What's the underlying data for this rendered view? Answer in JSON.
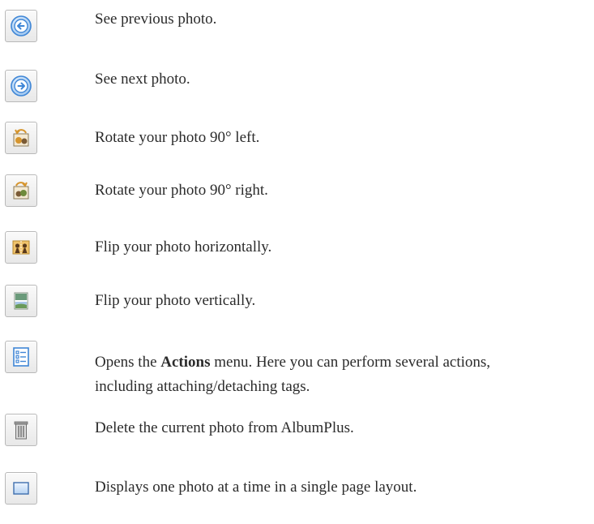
{
  "items": [
    {
      "icon": "previous-arrow-icon",
      "text": "See previous photo."
    },
    {
      "icon": "next-arrow-icon",
      "text": "See next photo."
    },
    {
      "icon": "rotate-left-icon",
      "text": "Rotate your photo 90° left."
    },
    {
      "icon": "rotate-right-icon",
      "text": "Rotate your photo 90° right."
    },
    {
      "icon": "flip-horizontal-icon",
      "text": "Flip your photo horizontally."
    },
    {
      "icon": "flip-vertical-icon",
      "text": "Flip your photo vertically."
    },
    {
      "icon": "actions-menu-icon",
      "text_before": "Opens the ",
      "bold": "Actions",
      "text_after": " menu. Here you can perform several actions,",
      "line2": "including attaching/detaching tags."
    },
    {
      "icon": "trash-icon",
      "text": "Delete the current photo from AlbumPlus."
    },
    {
      "icon": "single-page-layout-icon",
      "text": "Displays one photo at a time in a single page layout."
    }
  ],
  "colors": {
    "text": "#2b2b2b",
    "arrow_blue": "#3f86d6",
    "button_border": "#b9b9b9",
    "photo_orange": "#d6952d"
  }
}
